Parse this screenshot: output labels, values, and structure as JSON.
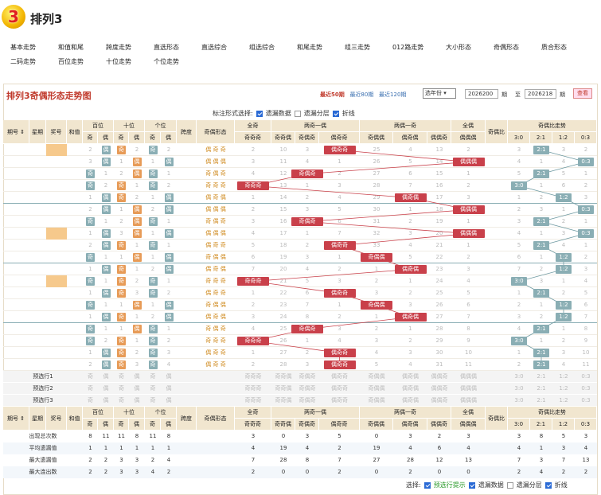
{
  "app": {
    "title": "排列3",
    "logo_text": "3",
    "brand_color": "#f3b400"
  },
  "menu": [
    "基本走势",
    "和值和尾",
    "跨度走势",
    "直选形态",
    "直选综合",
    "组选综合",
    "和尾走势",
    "组三走势",
    "012路走势",
    "大小形态",
    "奇偶形态",
    "质合形态",
    "二码走势",
    "百位走势",
    "十位走势",
    "个位走势"
  ],
  "panel": {
    "title": "排列3奇偶形态走势图",
    "periods": [
      "最近50期",
      "最近80期",
      "最近120期"
    ],
    "year_select": "选年份",
    "from": "2026200",
    "to": "2026218",
    "label_qi": "期",
    "label_zhi": "至",
    "query": "查看"
  },
  "mark": {
    "label": "标注形式选择:",
    "options": [
      {
        "label": "遗漏数据",
        "on": true
      },
      {
        "label": "遗漏分层",
        "on": false
      },
      {
        "label": "折线",
        "on": true
      }
    ]
  },
  "headers": {
    "qihao": "期号",
    "xingqi": "星期",
    "jianghao": "奖号",
    "hezhi": "和值",
    "bai": "百位",
    "shi": "十位",
    "ge": "个位",
    "kuadu": "跨度",
    "xingtai": "奇偶形态",
    "quanqi": "全奇",
    "liangqi": "两奇一偶",
    "liangou": "两偶一奇",
    "quanou": "全偶",
    "ratio": "奇偶比",
    "trend": "奇偶比走势",
    "ji": "奇",
    "ou": "偶",
    "pat_qqq": "奇奇奇",
    "pat_qqo": "奇奇偶",
    "pat_qoq": "奇偶奇",
    "pat_oqq": "偶奇奇",
    "pat_qoo": "奇偶偶",
    "pat_oqo": "偶奇偶",
    "pat_ooq": "偶偶奇",
    "pat_ooo": "偶偶偶",
    "r30": "3:0",
    "r21": "2:1",
    "r12": "1:2",
    "r03": "0:3"
  },
  "rows": [
    {
      "q": "2026200",
      "w": "3",
      "n": "077",
      "s": "14",
      "k": "7",
      "r": "2:1"
    },
    {
      "q": "2026201",
      "w": "4",
      "n": "862",
      "s": "16",
      "k": "6",
      "r": "0:3"
    },
    {
      "q": "2026202",
      "w": "6",
      "n": "961",
      "s": "16",
      "k": "8",
      "r": "2:1"
    },
    {
      "q": "2026203",
      "w": "6",
      "n": "135",
      "s": "9",
      "k": "4",
      "r": "3:0"
    },
    {
      "q": "2026204",
      "w": "7",
      "n": "674",
      "s": "17",
      "k": "3",
      "r": "1:2"
    },
    {
      "q": "2026205",
      "w": "1",
      "n": "806",
      "s": "14",
      "k": "8",
      "r": "0:3"
    },
    {
      "q": "2026206",
      "w": "2",
      "n": "709",
      "s": "16",
      "k": "9",
      "r": "2:1"
    },
    {
      "q": "2026207",
      "w": "3",
      "n": "866",
      "s": "20",
      "k": "2",
      "r": "0:3"
    },
    {
      "q": "2026208",
      "w": "4",
      "n": "471",
      "s": "12",
      "k": "6",
      "r": "2:1"
    },
    {
      "q": "2026209",
      "w": "5",
      "n": "982",
      "s": "19",
      "k": "7",
      "r": "1:2"
    },
    {
      "q": "2026210",
      "w": "6",
      "n": "094",
      "s": "13",
      "k": "9",
      "r": "1:2"
    },
    {
      "q": "2026211",
      "w": "7",
      "n": "515",
      "s": "11",
      "k": "4",
      "r": "3:0"
    },
    {
      "q": "2026212",
      "w": "1",
      "n": "839",
      "s": "20",
      "k": "6",
      "r": "2:1"
    },
    {
      "q": "2026213",
      "w": "2",
      "n": "740",
      "s": "11",
      "k": "7",
      "r": "1:2"
    },
    {
      "q": "2026214",
      "w": "3",
      "n": "014",
      "s": "5",
      "k": "4",
      "r": "1:2"
    },
    {
      "q": "2026215",
      "w": "4",
      "n": "927",
      "s": "18",
      "k": "7",
      "r": "2:1"
    },
    {
      "q": "2026216",
      "w": "5",
      "n": "953",
      "s": "17",
      "k": "6",
      "r": "3:0"
    },
    {
      "q": "2026217",
      "w": "6",
      "n": "019",
      "s": "10",
      "k": "9",
      "r": "2:1"
    },
    {
      "q": "2026218",
      "w": "7",
      "n": "079",
      "s": "16",
      "k": "9",
      "r": "2:1"
    }
  ],
  "forecast": [
    "预选行1",
    "预选行2",
    "预选行3"
  ],
  "stats": [
    {
      "label": "出现总次数",
      "v": [
        "8",
        "11",
        "11",
        "8",
        "11",
        "8",
        "3",
        "0",
        "3",
        "5",
        "0",
        "3",
        "2",
        "3",
        "3",
        "8",
        "5",
        "3"
      ]
    },
    {
      "label": "平均遗漏值",
      "v": [
        "1",
        "1",
        "1",
        "1",
        "1",
        "1",
        "4",
        "19",
        "4",
        "2",
        "19",
        "4",
        "6",
        "4",
        "4",
        "1",
        "3",
        "4"
      ]
    },
    {
      "label": "最大遗漏值",
      "v": [
        "2",
        "2",
        "3",
        "3",
        "2",
        "4",
        "7",
        "28",
        "8",
        "7",
        "27",
        "28",
        "12",
        "13",
        "7",
        "3",
        "7",
        "13"
      ]
    },
    {
      "label": "最大连出数",
      "v": [
        "2",
        "2",
        "3",
        "3",
        "4",
        "2",
        "2",
        "0",
        "0",
        "2",
        "0",
        "2",
        "0",
        "0",
        "2",
        "4",
        "2",
        "2"
      ]
    }
  ],
  "footer": {
    "label": "选择:",
    "options": [
      {
        "label": "预选行提示",
        "on": true,
        "green": true
      },
      {
        "label": "遗漏数据",
        "on": true
      },
      {
        "label": "遗漏分层",
        "on": false
      },
      {
        "label": "折线",
        "on": true
      }
    ]
  }
}
